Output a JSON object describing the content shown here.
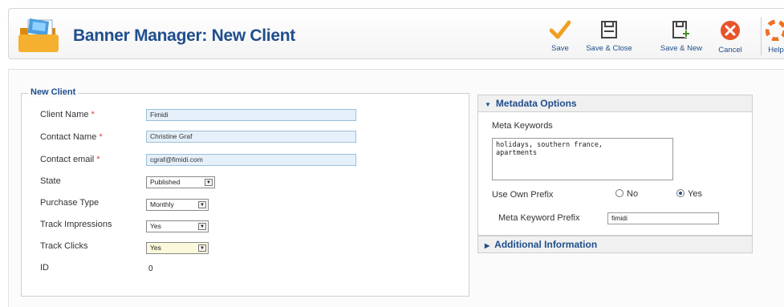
{
  "header": {
    "title": "Banner Manager: New Client"
  },
  "toolbar": {
    "save": {
      "label": "Save",
      "icon": "checkmark-icon",
      "color": "#f0a020"
    },
    "save_close": {
      "label": "Save & Close",
      "icon": "floppy-disk-icon"
    },
    "save_new": {
      "label": "Save & New",
      "icon": "floppy-disk-plus-icon"
    },
    "cancel": {
      "label": "Cancel",
      "icon": "cancel-circle-icon",
      "color": "#e8542a"
    },
    "help": {
      "label": "Help",
      "icon": "help-lifebuoy-icon",
      "color": "#f07020"
    }
  },
  "form": {
    "legend": "New Client",
    "fields": {
      "client_name": {
        "label": "Client Name",
        "required_mark": "*",
        "value": "Fimidi"
      },
      "contact_name": {
        "label": "Contact Name",
        "required_mark": "*",
        "value": "Christine Graf"
      },
      "contact_email": {
        "label": "Contact email",
        "required_mark": "*",
        "value": "cgraf@fimidi.com"
      },
      "state": {
        "label": "State",
        "value": "Published"
      },
      "purchase_type": {
        "label": "Purchase Type",
        "value": "Monthly"
      },
      "track_impressions": {
        "label": "Track Impressions",
        "value": "Yes"
      },
      "track_clicks": {
        "label": "Track Clicks",
        "value": "Yes"
      },
      "id": {
        "label": "ID",
        "value": "0"
      }
    }
  },
  "metadata": {
    "title": "Metadata Options",
    "meta_keywords_label": "Meta Keywords",
    "meta_keywords_value": "holidays, southern france,\napartments",
    "use_own_prefix_label": "Use Own Prefix",
    "use_own_prefix_options": [
      "No",
      "Yes"
    ],
    "use_own_prefix_selected": "Yes",
    "meta_keyword_prefix_label": "Meta Keyword Prefix",
    "meta_keyword_prefix_value": "fimidi"
  },
  "additional": {
    "title": "Additional Information"
  },
  "colors": {
    "accent": "#1f4e8c",
    "input_highlight": "#e5f0fa",
    "required": "#dd4444"
  }
}
